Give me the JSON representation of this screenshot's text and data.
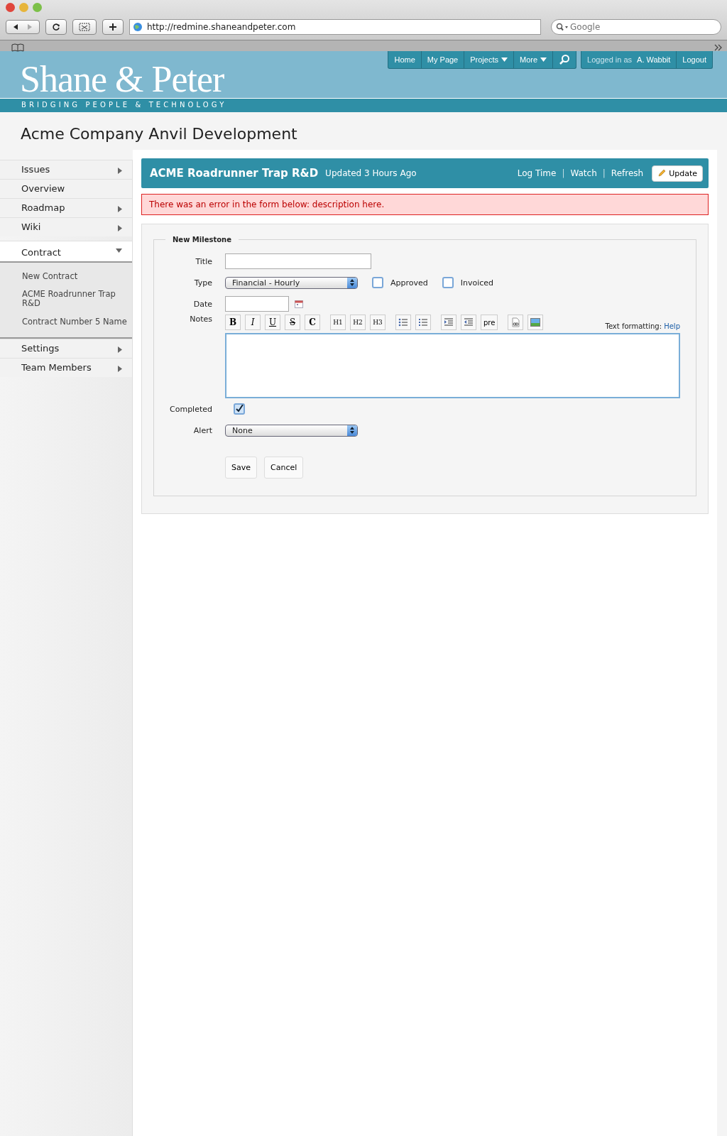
{
  "browser": {
    "url": "http://redmine.shaneandpeter.com",
    "search_placeholder": "Google"
  },
  "header": {
    "logo": "Shane & Peter",
    "tagline": "BRIDGING PEOPLE & TECHNOLOGY",
    "nav": [
      {
        "label": "Home",
        "dropdown": false
      },
      {
        "label": "My Page",
        "dropdown": false
      },
      {
        "label": "Projects",
        "dropdown": true
      },
      {
        "label": "More",
        "dropdown": true
      }
    ],
    "user": {
      "prefix": "Logged in as",
      "name": "A. Wabbit",
      "logout": "Logout"
    }
  },
  "project_title": "Acme Company Anvil Development",
  "sidebar": {
    "items": [
      {
        "label": "Issues",
        "expanded": false
      },
      {
        "label": "Overview"
      },
      {
        "label": "Roadmap",
        "expanded": false
      },
      {
        "label": "Wiki",
        "expanded": false
      },
      {
        "label": "Contract",
        "expanded": true,
        "children": [
          {
            "label": "New Contract"
          },
          {
            "label": "ACME Roadrunner Trap R&D"
          },
          {
            "label": "Contract Number 5 Name"
          }
        ]
      },
      {
        "label": "Settings",
        "expanded": false
      },
      {
        "label": "Team Members",
        "expanded": false
      }
    ]
  },
  "content": {
    "title": "ACME Roadrunner Trap R&D",
    "subtitle": "Updated 3 Hours Ago",
    "actions": [
      "Log Time",
      "Watch",
      "Refresh"
    ],
    "action_separator": "|",
    "update_button": "Update",
    "error": "There was an error in the form below: description here.",
    "form": {
      "legend": "New Milestone",
      "title": {
        "label": "Title"
      },
      "type": {
        "label": "Type",
        "value": "Financial - Hourly"
      },
      "approved": {
        "label": "Approved",
        "checked": false
      },
      "invoiced": {
        "label": "Invoiced",
        "checked": false
      },
      "date": {
        "label": "Date"
      },
      "notes": {
        "label": "Notes",
        "format_buttons": [
          "B",
          "I",
          "U",
          "S",
          "C",
          "H1",
          "H2",
          "H3"
        ],
        "pre_button": "pre",
        "help_prefix": "Text formatting:",
        "help_link": "Help"
      },
      "completed": {
        "label": "Completed",
        "checked": true
      },
      "alert": {
        "label": "Alert",
        "value": "None"
      },
      "buttons": [
        "Save",
        "Cancel"
      ]
    }
  }
}
